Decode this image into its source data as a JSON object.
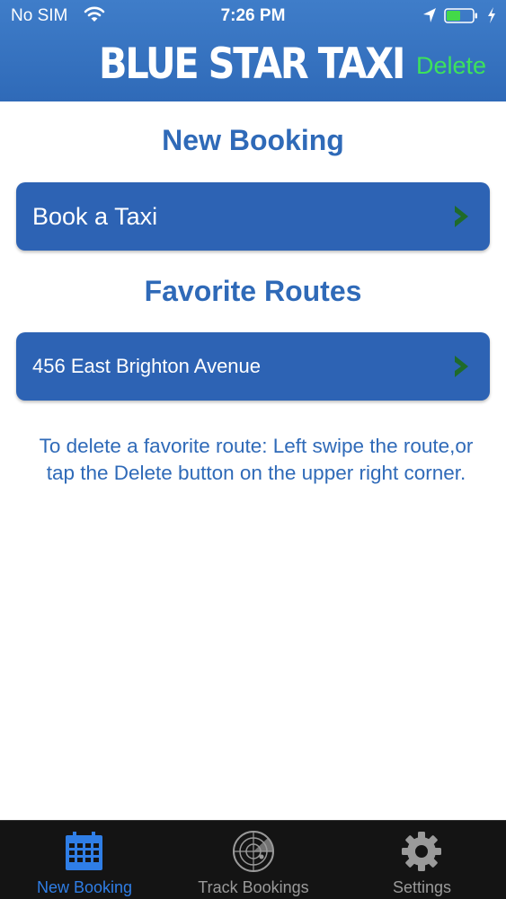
{
  "status_bar": {
    "carrier": "No SIM",
    "time": "7:26 PM"
  },
  "header": {
    "title": "BLUE STAR TAXI",
    "delete_label": "Delete"
  },
  "main": {
    "new_booking_heading": "New Booking",
    "book_taxi_label": "Book a Taxi",
    "favorite_routes_heading": "Favorite Routes",
    "routes": [
      "456 East Brighton Avenue"
    ],
    "delete_hint": "To delete a favorite route: Left swipe the route,or tap the Delete button on the upper right corner."
  },
  "tab_bar": {
    "tabs": [
      {
        "label": "New Booking",
        "icon": "calendar-icon",
        "active": true
      },
      {
        "label": "Track Bookings",
        "icon": "radar-icon",
        "active": false
      },
      {
        "label": "Settings",
        "icon": "gear-icon",
        "active": false
      }
    ]
  },
  "colors": {
    "header_blue": "#3470be",
    "card_blue": "#2d63b4",
    "text_blue": "#2f6ab8",
    "delete_green": "#3de25b",
    "chevron_green": "#1f6b2a",
    "active_tab": "#2f7ee6",
    "inactive_tab": "#9a9a9a"
  }
}
